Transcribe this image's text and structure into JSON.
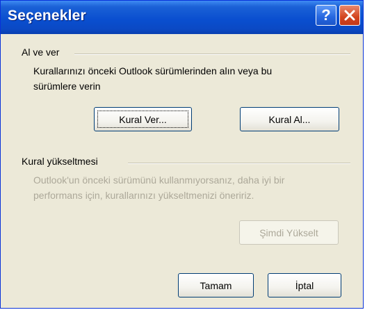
{
  "window": {
    "title": "Seçenekler"
  },
  "title_buttons": {
    "help_glyph": "?",
    "help_icon": "question-mark-icon",
    "close_icon": "close-x-icon"
  },
  "al_ve_ver": {
    "heading": "Al ve ver",
    "description_line1": "Kurallarınızı önceki Outlook sürümlerinden alın veya bu",
    "description_line2": "sürümlere verin",
    "kural_ver_label": "Kural Ver...",
    "kural_al_label": "Kural Al..."
  },
  "kural_yukseltmesi": {
    "heading": "Kural yükseltmesi",
    "description_line1": "Outlook'un önceki sürümünü kullanmıyorsanız, daha iyi bir",
    "description_line2": "performans için, kurallarınızı yükseltmenizi öneririz.",
    "upgrade_now_label": "Şimdi Yükselt"
  },
  "footer": {
    "ok_label": "Tamam",
    "cancel_label": "İptal"
  },
  "colors": {
    "titlebar": "#0a4fd0",
    "dialog_bg": "#ece9d8",
    "disabled_text": "#aca899",
    "close_button": "#d3441e"
  }
}
